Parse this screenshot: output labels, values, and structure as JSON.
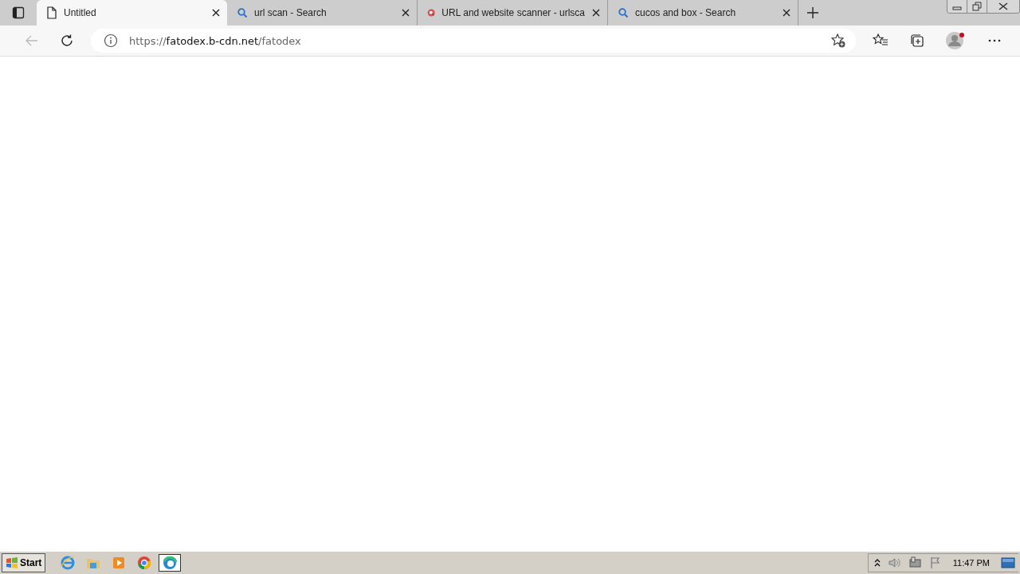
{
  "tabs": [
    {
      "title": "Untitled",
      "kind": "page",
      "selected": true
    },
    {
      "title": "url scan - Search",
      "kind": "search",
      "selected": false
    },
    {
      "title": "URL and website scanner - urlsca",
      "kind": "scanner",
      "selected": false
    },
    {
      "title": "cucos and box - Search",
      "kind": "search",
      "selected": false
    }
  ],
  "toolbar": {
    "back_disabled": true,
    "url": {
      "scheme": "https://",
      "host": "fatodex.b-cdn.net",
      "path": "/fatodex"
    },
    "profile_notification": true
  },
  "taskbar": {
    "start_label": "Start",
    "apps": [
      {
        "kind": "ie",
        "selected": false
      },
      {
        "kind": "explorer",
        "selected": false
      },
      {
        "kind": "media",
        "selected": false
      },
      {
        "kind": "chrome",
        "selected": false
      },
      {
        "kind": "edge",
        "selected": true
      }
    ],
    "clock": "11:47 PM"
  }
}
